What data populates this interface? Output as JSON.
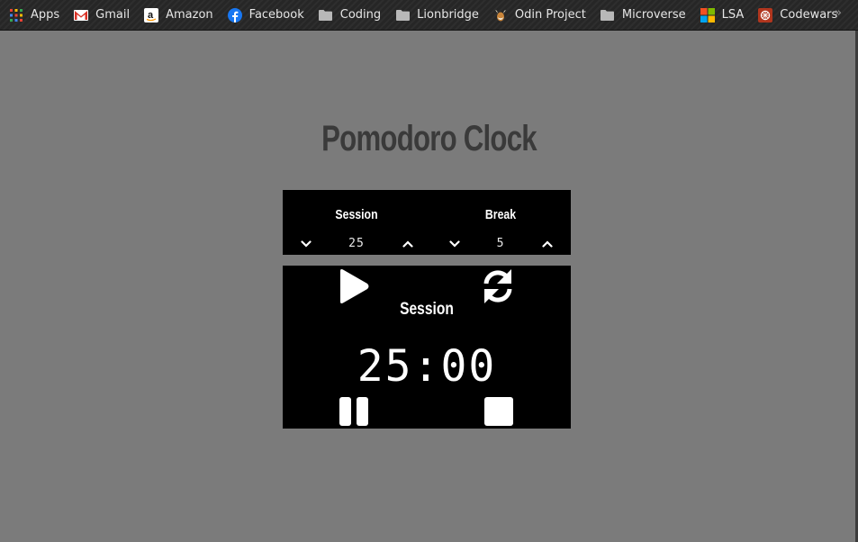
{
  "bookmarks": [
    {
      "label": "Apps",
      "icon": "apps-grid-icon"
    },
    {
      "label": "Gmail",
      "icon": "gmail-icon"
    },
    {
      "label": "Amazon",
      "icon": "amazon-icon"
    },
    {
      "label": "Facebook",
      "icon": "facebook-icon"
    },
    {
      "label": "Coding",
      "icon": "folder-icon"
    },
    {
      "label": "Lionbridge",
      "icon": "folder-icon"
    },
    {
      "label": "Odin Project",
      "icon": "odin-project-icon"
    },
    {
      "label": "Microverse",
      "icon": "folder-icon"
    },
    {
      "label": "LSA",
      "icon": "microsoft-icon"
    },
    {
      "label": "Codewars",
      "icon": "codewars-icon"
    }
  ],
  "overflow_symbol": "»",
  "app": {
    "title": "Pomodoro Clock",
    "session_label": "Session",
    "break_label": "Break",
    "session_length": "25",
    "break_length": "5",
    "current_mode": "Session",
    "time_left": "25:00"
  },
  "colors": {
    "page_bg": "#7b7b7b",
    "panel_bg": "#000000",
    "title": "#3a3a3a",
    "bookmark_bar": "#262626"
  }
}
